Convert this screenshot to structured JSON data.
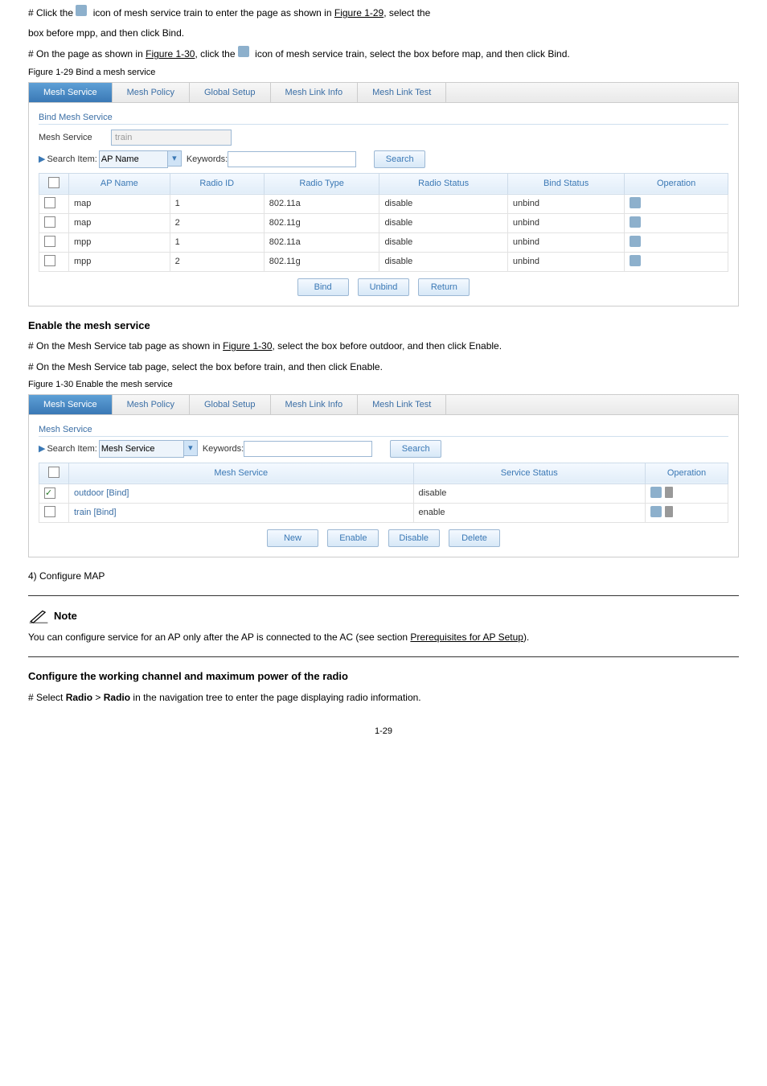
{
  "intro1_prefix": "# Click the ",
  "intro1_icon": "op-icon",
  "intro1_suffix": " icon of mesh service train to enter the page as shown in ",
  "intro1_link": "Figure 1-29",
  "intro1_tail": ", select the ",
  "intro1_cont": "box before mpp, and then click Bind.",
  "intro2_p1": "# On the page as shown in ",
  "intro2_l1": "Figure 1-30",
  "intro2_p2": ", click the ",
  "intro2_p3": " icon of mesh service train, select the box before map, and then click Bind.",
  "fig29": "Figure 1-29 Bind a mesh service",
  "tabs": [
    "Mesh Service",
    "Mesh Policy",
    "Global Setup",
    "Mesh Link Info",
    "Mesh Link Test"
  ],
  "b1": {
    "title": "Bind Mesh Service",
    "label": "Mesh Service",
    "value": "train",
    "search_label": "Search Item:",
    "item": "AP Name",
    "kw": "Keywords:",
    "search_btn": "Search",
    "headers": [
      "AP Name",
      "Radio ID",
      "Radio Type",
      "Radio Status",
      "Bind Status",
      "Operation"
    ],
    "rows": [
      {
        "ap": "map",
        "rid": "1",
        "rt": "802.11a",
        "rs": "disable",
        "bs": "unbind"
      },
      {
        "ap": "map",
        "rid": "2",
        "rt": "802.11g",
        "rs": "disable",
        "bs": "unbind"
      },
      {
        "ap": "mpp",
        "rid": "1",
        "rt": "802.11a",
        "rs": "disable",
        "bs": "unbind"
      },
      {
        "ap": "mpp",
        "rid": "2",
        "rt": "802.11g",
        "rs": "disable",
        "bs": "unbind"
      }
    ],
    "btns": [
      "Bind",
      "Unbind",
      "Return"
    ]
  },
  "enable_hdr": "Enable the mesh service",
  "enable_p1": "# On the Mesh Service tab page as shown in ",
  "enable_l1": "Figure 1-30",
  "enable_p2": ", select the box before outdoor, and then click Enable.",
  "enable_p3": "# On the Mesh Service tab page, select the box before train, and then click Enable.",
  "fig30": "Figure 1-30 Enable the mesh service",
  "b2": {
    "title": "Mesh Service",
    "search_label": "Search Item:",
    "item": "Mesh Service",
    "kw": "Keywords:",
    "search_btn": "Search",
    "headers": [
      "Mesh Service",
      "Service Status",
      "Operation"
    ],
    "rows": [
      {
        "ms": "outdoor [Bind]",
        "st": "disable",
        "chk": true
      },
      {
        "ms": "train [Bind]",
        "st": "enable",
        "chk": false
      }
    ],
    "btns": [
      "New",
      "Enable",
      "Disable",
      "Delete"
    ]
  },
  "step4": "4) Configure MAP",
  "note": "Note",
  "note_p1": "You can configure service for an AP only after the AP is connected to the AC (see section ",
  "note_link": "Prerequisites for AP Setup",
  "note_p2": ").",
  "radio_hdr": "Configure the working channel and maximum power of the radio",
  "radio_p1_a": "# Select ",
  "radio_p1_b": "Radio",
  "radio_p1_c": " > ",
  "radio_p1_d": "Radio",
  "radio_p1_e": " in the navigation tree to enter the page displaying radio information.",
  "pg": "1-29"
}
